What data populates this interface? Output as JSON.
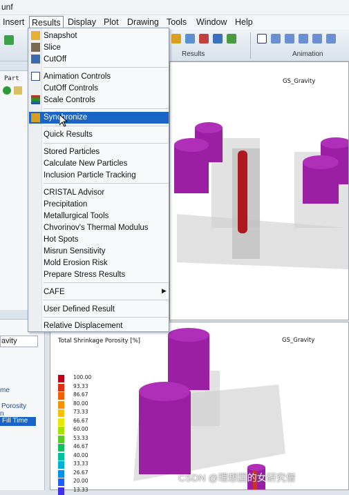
{
  "app": {
    "title": "unf"
  },
  "menubar": {
    "items": [
      "Insert",
      "Results",
      "Display",
      "Plot",
      "Drawing",
      "Tools",
      "Window",
      "Help"
    ]
  },
  "toolbar": {
    "groups": [
      {
        "label": "Results"
      },
      {
        "label": "Animation"
      }
    ]
  },
  "left_panel": {
    "tab_label": "Part",
    "gravity_field": "avity",
    "list_items": [
      "me",
      "Porosity",
      "n",
      "Fill Time"
    ]
  },
  "results_menu": {
    "items": [
      {
        "label": "Snapshot",
        "icon": "snapshot-icon"
      },
      {
        "label": "Slice",
        "icon": "slice-icon"
      },
      {
        "label": "CutOff",
        "icon": "cutoff-icon"
      },
      {
        "label": "Animation Controls",
        "icon": "animation-controls-icon"
      },
      {
        "label": "CutOff Controls"
      },
      {
        "label": "Scale Controls",
        "icon": "scale-controls-icon"
      },
      {
        "label": "Synchronize",
        "icon": "synchronize-icon",
        "highlighted": true
      },
      {
        "label": "Quick Results"
      },
      {
        "label": "Stored Particles"
      },
      {
        "label": "Calculate New Particles"
      },
      {
        "label": "Inclusion Particle Tracking"
      },
      {
        "label": "CRISTAL Advisor"
      },
      {
        "label": "Precipitation"
      },
      {
        "label": "Metallurgical Tools"
      },
      {
        "label": "Chvorinov's Thermal Modulus"
      },
      {
        "label": "Hot Spots"
      },
      {
        "label": "Misrun Sensitivity"
      },
      {
        "label": "Mold Erosion Risk"
      },
      {
        "label": "Prepare Stress Results"
      },
      {
        "label": "CAFE",
        "submenu": true
      },
      {
        "label": "User Defined Result"
      },
      {
        "label": "Relative Displacement"
      }
    ]
  },
  "viewport_top": {
    "label": "GS_Gravity"
  },
  "viewport_bottom": {
    "label": "GS_Gravity",
    "result_title": "Total Shrinkage Porosity [%]",
    "legend": [
      {
        "value": "100.00",
        "color": "#c00018"
      },
      {
        "value": "93.33",
        "color": "#e03010"
      },
      {
        "value": "86.67",
        "color": "#f06008"
      },
      {
        "value": "80.00",
        "color": "#f89000"
      },
      {
        "value": "73.33",
        "color": "#f8c000"
      },
      {
        "value": "66.67",
        "color": "#e8e800"
      },
      {
        "value": "60.00",
        "color": "#a8e000"
      },
      {
        "value": "53.33",
        "color": "#58d020"
      },
      {
        "value": "46.67",
        "color": "#10c060"
      },
      {
        "value": "40.00",
        "color": "#00c0a0"
      },
      {
        "value": "33.33",
        "color": "#00b0d8"
      },
      {
        "value": "26.67",
        "color": "#0090f0"
      },
      {
        "value": "20.00",
        "color": "#2060f8"
      },
      {
        "value": "13.33",
        "color": "#4030e8"
      }
    ]
  },
  "watermark": "CSDN @理想国的女研究僧",
  "colors": {
    "casting": "#9b1fa3",
    "highlight": "#1a64c7"
  }
}
